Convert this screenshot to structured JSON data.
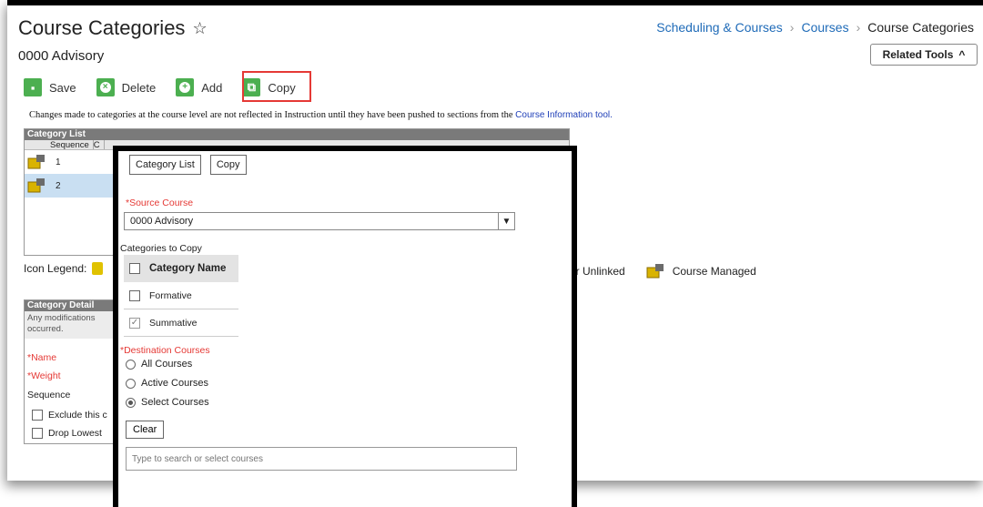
{
  "header": {
    "title": "Course Categories",
    "subtitle": "0000 Advisory",
    "breadcrumb": [
      "Scheduling & Courses",
      "Courses",
      "Course Categories"
    ],
    "related_tools": "Related Tools"
  },
  "toolbar": {
    "save": "Save",
    "delete": "Delete",
    "add": "Add",
    "copy": "Copy",
    "highlight_color": "#e53935",
    "icon_color": "#4caf50"
  },
  "notice": {
    "text": "Changes made to categories at the course level are not reflected in Instruction until they have been pushed to sections from the",
    "link": "Course Information tool."
  },
  "category_list": {
    "title": "Category List",
    "columns": [
      "Sequence",
      "C"
    ],
    "rows": [
      {
        "sequence": "1",
        "selected": false
      },
      {
        "sequence": "2",
        "selected": true
      }
    ]
  },
  "legend": {
    "label": "Icon Legend:",
    "unlinked": "er Unlinked",
    "course_managed": "Course Managed"
  },
  "category_detail": {
    "title": "Category Detail",
    "description": "Any modifications occurred.",
    "name_label": "*Name",
    "weight_label": "*Weight",
    "sequence_label": "Sequence",
    "exclude_label": "Exclude this c",
    "drop_lowest_label": "Drop Lowest"
  },
  "modal": {
    "tabs": [
      "Category List",
      "Copy"
    ],
    "source_course_label": "*Source Course",
    "source_course_value": "0000 Advisory",
    "categories_label": "Categories to Copy",
    "category_header": "Category Name",
    "categories": [
      {
        "name": "Formative",
        "checked": false
      },
      {
        "name": "Summative",
        "checked": true
      }
    ],
    "destination_label": "*Destination Courses",
    "destination_options": [
      {
        "label": "All Courses",
        "selected": false
      },
      {
        "label": "Active Courses",
        "selected": false
      },
      {
        "label": "Select Courses",
        "selected": true
      }
    ],
    "clear_button": "Clear",
    "search_placeholder": "Type to search or select courses"
  }
}
